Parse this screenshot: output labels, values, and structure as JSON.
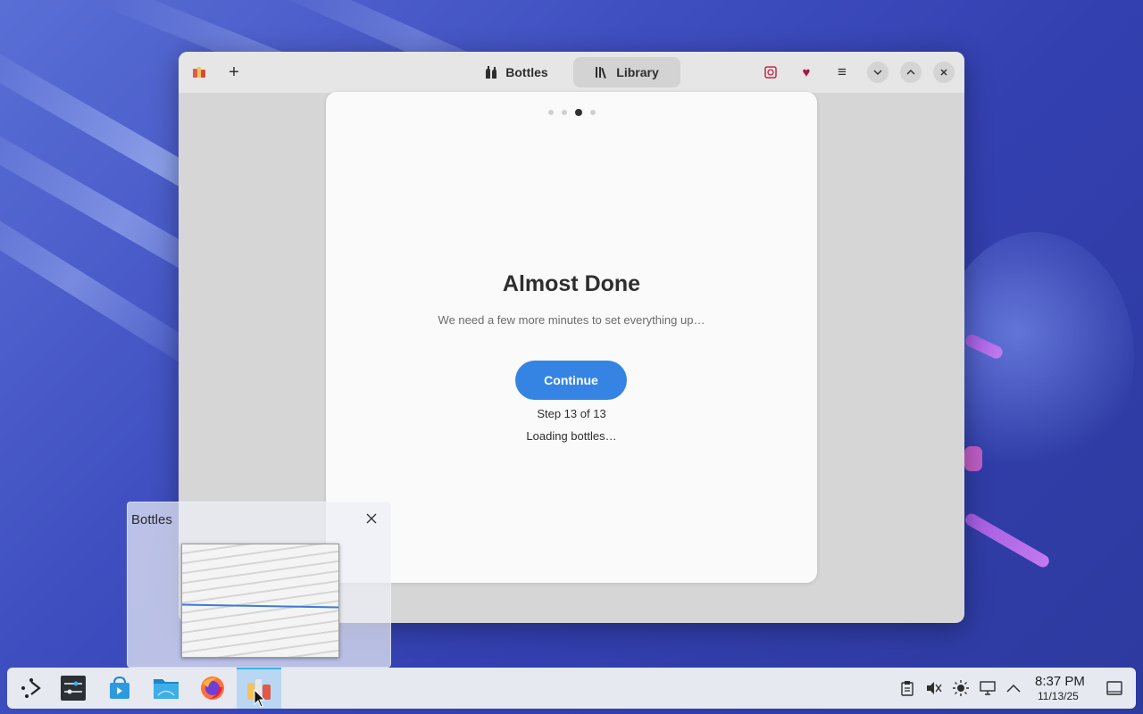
{
  "window": {
    "tabs": [
      {
        "label": "Bottles",
        "icon": "bottles-icon",
        "active": false
      },
      {
        "label": "Library",
        "icon": "library-icon",
        "active": true
      }
    ],
    "left_buttons": [
      {
        "icon": "bottles-app-icon"
      },
      {
        "icon": "plus-icon"
      }
    ],
    "right_buttons": [
      {
        "icon": "donate-icon"
      },
      {
        "icon": "heart-icon"
      },
      {
        "icon": "hamburger-menu-icon"
      }
    ],
    "controls": [
      {
        "icon": "minimize-icon"
      },
      {
        "icon": "maximize-icon"
      },
      {
        "icon": "close-icon"
      }
    ]
  },
  "onboarding": {
    "page_count": 4,
    "active_page": 3,
    "title": "Almost Done",
    "subtitle": "We need a few more minutes to set everything up…",
    "continue_label": "Continue",
    "step_text": "Step 13 of 13",
    "status_text": "Loading bottles…"
  },
  "preview": {
    "title": "Bottles"
  },
  "taskbar": {
    "apps": [
      {
        "name": "application-launcher-icon"
      },
      {
        "name": "system-settings-icon"
      },
      {
        "name": "discover-store-icon"
      },
      {
        "name": "file-manager-icon"
      },
      {
        "name": "firefox-icon"
      },
      {
        "name": "bottles-app-icon",
        "active": true
      }
    ],
    "tray": [
      {
        "name": "clipboard-icon"
      },
      {
        "name": "volume-muted-icon"
      },
      {
        "name": "brightness-icon"
      },
      {
        "name": "display-icon"
      },
      {
        "name": "chevron-up-icon"
      }
    ],
    "clock_time": "8:37 PM",
    "clock_date": "11/13/25"
  },
  "colors": {
    "accent": "#3584e4",
    "heart": "#a0184b",
    "donate": "#c0284a"
  }
}
